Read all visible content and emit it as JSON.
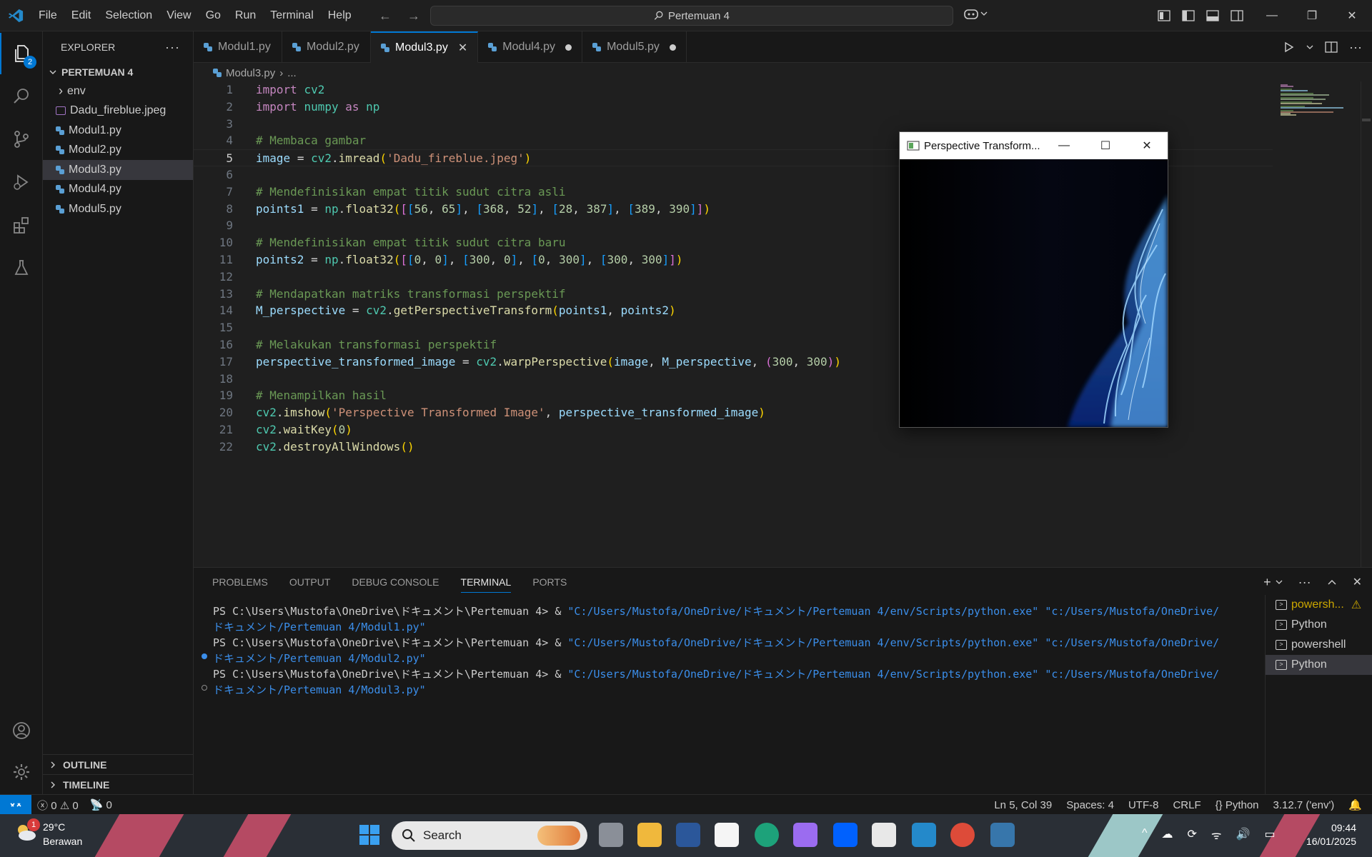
{
  "menu": [
    "File",
    "Edit",
    "Selection",
    "View",
    "Go",
    "Run",
    "Terminal",
    "Help"
  ],
  "command_center": "Pertemuan 4",
  "explorer": {
    "title": "EXPLORER",
    "badge": "2",
    "folder": "PERTEMUAN 4",
    "items": [
      {
        "label": "env",
        "type": "folder"
      },
      {
        "label": "Dadu_fireblue.jpeg",
        "type": "image"
      },
      {
        "label": "Modul1.py",
        "type": "python"
      },
      {
        "label": "Modul2.py",
        "type": "python"
      },
      {
        "label": "Modul3.py",
        "type": "python",
        "selected": true
      },
      {
        "label": "Modul4.py",
        "type": "python"
      },
      {
        "label": "Modul5.py",
        "type": "python"
      }
    ],
    "outline": "OUTLINE",
    "timeline": "TIMELINE"
  },
  "tabs": [
    {
      "label": "Modul1.py",
      "state": "none"
    },
    {
      "label": "Modul2.py",
      "state": "none"
    },
    {
      "label": "Modul3.py",
      "state": "active"
    },
    {
      "label": "Modul4.py",
      "state": "dirty"
    },
    {
      "label": "Modul5.py",
      "state": "dirty"
    }
  ],
  "breadcrumb": {
    "file": "Modul3.py",
    "rest": "..."
  },
  "code_lines": [
    "import cv2",
    "import numpy as np",
    "",
    "# Membaca gambar",
    "image = cv2.imread('Dadu_fireblue.jpeg')",
    "",
    "# Mendefinisikan empat titik sudut citra asli",
    "points1 = np.float32([[56, 65], [368, 52], [28, 387], [389, 390]])",
    "",
    "# Mendefinisikan empat titik sudut citra baru",
    "points2 = np.float32([[0, 0], [300, 0], [0, 300], [300, 300]])",
    "",
    "# Mendapatkan matriks transformasi perspektif",
    "M_perspective = cv2.getPerspectiveTransform(points1, points2)",
    "",
    "# Melakukan transformasi perspektif",
    "perspective_transformed_image = cv2.warpPerspective(image, M_perspective, (300, 300))",
    "",
    "# Menampilkan hasil",
    "cv2.imshow('Perspective Transformed Image', perspective_transformed_image)",
    "cv2.waitKey(0)",
    "cv2.destroyAllWindows()"
  ],
  "current_line": 5,
  "cv_window": {
    "title": "Perspective Transform..."
  },
  "panel": {
    "tabs": [
      "PROBLEMS",
      "OUTPUT",
      "DEBUG CONSOLE",
      "TERMINAL",
      "PORTS"
    ],
    "active_tab": "TERMINAL",
    "terminal": [
      {
        "prompt": "PS C:\\Users\\Mustofa\\OneDrive\\ドキュメント\\Pertemuan 4> & ",
        "cmd": "\"C:/Users/Mustofa/OneDrive/ドキュメント/Pertemuan 4/env/Scripts/python.exe\" \"c:/Users/Mustofa/OneDrive/",
        "cont": "ドキュメント/Pertemuan 4/Modul1.py\"",
        "dot": "none"
      },
      {
        "prompt": "PS C:\\Users\\Mustofa\\OneDrive\\ドキュメント\\Pertemuan 4> & ",
        "cmd": "\"C:/Users/Mustofa/OneDrive/ドキュメント/Pertemuan 4/env/Scripts/python.exe\" \"c:/Users/Mustofa/OneDrive/",
        "cont": "ドキュメント/Pertemuan 4/Modul2.py\"",
        "dot": "blue"
      },
      {
        "prompt": "PS C:\\Users\\Mustofa\\OneDrive\\ドキュメント\\Pertemuan 4> & ",
        "cmd": "\"C:/Users/Mustofa/OneDrive/ドキュメント/Pertemuan 4/env/Scripts/python.exe\" \"c:/Users/Mustofa/OneDrive/",
        "cont": "ドキュメント/Pertemuan 4/Modul3.py\"",
        "dot": "blue"
      }
    ],
    "terminal_list": [
      {
        "label": "powersh...",
        "warning": true,
        "selected": false
      },
      {
        "label": "Python",
        "warning": false,
        "selected": false
      },
      {
        "label": "powershell",
        "warning": false,
        "selected": false
      },
      {
        "label": "Python",
        "warning": false,
        "selected": true
      }
    ]
  },
  "status": {
    "errors": "0",
    "warnings": "0",
    "ports": "0",
    "position": "Ln 5, Col 39",
    "spaces": "Spaces: 4",
    "encoding": "UTF-8",
    "eol": "CRLF",
    "language": "Python",
    "interpreter": "3.12.7 ('env')"
  },
  "taskbar": {
    "weather_badge": "1",
    "temperature": "29°C",
    "condition": "Berawan",
    "search": "Search",
    "time": "09:44",
    "date": "16/01/2025"
  },
  "colors": {
    "accent": "#0078d4",
    "python_blue": "#5a9fd4",
    "terminal_string": "#3b8eea"
  }
}
